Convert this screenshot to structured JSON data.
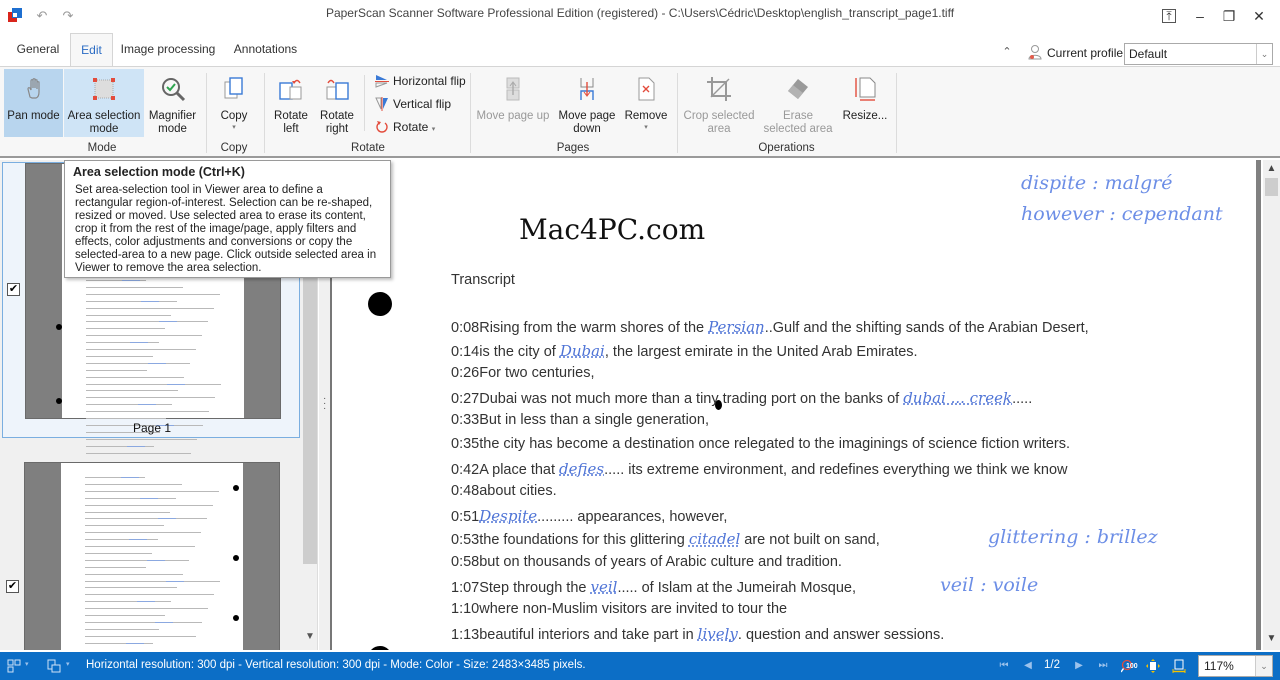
{
  "window": {
    "title": "PaperScan Scanner Software Professional Edition (registered) - C:\\Users\\Cédric\\Desktop\\english_transcript_page1.tiff",
    "undo_icon": "↶",
    "redo_icon": "↷",
    "pin_icon": "⤒",
    "minimize_icon": "–",
    "restore_icon": "❐",
    "close_icon": "✕"
  },
  "ribbon_tabs": [
    {
      "label": "General",
      "active": false
    },
    {
      "label": "Edit",
      "active": true
    },
    {
      "label": "Image processing",
      "active": false
    },
    {
      "label": "Annotations",
      "active": false
    }
  ],
  "profile": {
    "collapse_icon": "⌃",
    "label": "Current profile:",
    "value": "Default",
    "arrow": "⌄"
  },
  "ribbon": {
    "groups": {
      "mode": "Mode",
      "copy": "Copy",
      "rotate": "Rotate",
      "pages": "Pages",
      "operations": "Operations"
    },
    "buttons": {
      "pan_mode": "Pan mode",
      "area_selection_l1": "Area selection",
      "area_selection_l2": "mode",
      "magnifier_l1": "Magnifier",
      "magnifier_l2": "mode",
      "copy": "Copy",
      "rotate_left_l1": "Rotate",
      "rotate_left_l2": "left",
      "rotate_right_l1": "Rotate",
      "rotate_right_l2": "right",
      "horizontal_flip": "Horizontal flip",
      "vertical_flip": "Vertical flip",
      "rotate": "Rotate",
      "move_page_up": "Move page up",
      "move_page_down_l1": "Move page",
      "move_page_down_l2": "down",
      "remove": "Remove",
      "crop_l1": "Crop selected",
      "crop_l2": "area",
      "erase_l1": "Erase",
      "erase_l2": "selected area",
      "resize": "Resize..."
    },
    "dropdown_arrow": "▾"
  },
  "tooltip": {
    "title": "Area selection mode (Ctrl+K)",
    "body": "Set area-selection tool in Viewer area to define a rectangular region-of-interest. Selection can be re-shaped, resized or moved. Use selected area to erase its content, crop it from the rest of the image/page, apply filters and effects, color adjustments and conversions or copy the selected-area to a new page. Click outside selected area in Viewer to remove the area selection."
  },
  "thumbnails": [
    {
      "label": "Page 1",
      "checked": true,
      "selected": true
    },
    {
      "label": "",
      "checked": true,
      "selected": false
    }
  ],
  "check_mark": "✔",
  "document": {
    "watermark": "Mac4PC.com",
    "heading": "Transcript",
    "lines": [
      {
        "ts": "0:08",
        "pre": "Rising from the warm shores of the ",
        "fill": "Persian",
        "post": "..Gulf and the shifting sands of the Arabian Desert,"
      },
      {
        "ts": "0:14",
        "pre": "is the city of ",
        "fill": "Dubai",
        "post": ", the largest emirate in the United Arab Emirates."
      },
      {
        "ts": "0:26",
        "pre": "For two centuries,",
        "fill": "",
        "post": ""
      },
      {
        "ts": "0:27",
        "pre": "Dubai was not much more than a tiny trading port on the banks of ",
        "fill": "dubai ... creek",
        "post": "....."
      },
      {
        "ts": "0:33",
        "pre": "But in less than a single generation,",
        "fill": "",
        "post": ""
      },
      {
        "ts": "0:35",
        "pre": "the city has become a destination once relegated to the imaginings of science fiction writers.",
        "fill": "",
        "post": ""
      },
      {
        "ts": "0:42",
        "pre": "A place that ",
        "fill": "defies",
        "post": "..... its extreme environment, and redefines everything we think we know"
      },
      {
        "ts": "0:48",
        "pre": "about cities.",
        "fill": "",
        "post": ""
      },
      {
        "ts": "0:51",
        "pre": "",
        "fill": "Despite",
        "post": "......... appearances, however,"
      },
      {
        "ts": "0:53",
        "pre": "the foundations for this glittering ",
        "fill": "citadel",
        "post": " are not built on sand,"
      },
      {
        "ts": "0:58",
        "pre": "but on thousands of years of Arabic culture and tradition.",
        "fill": "",
        "post": ""
      },
      {
        "ts": "1:07",
        "pre": "Step through the ",
        "fill": "veil",
        "post": "..... of Islam at the Jumeirah Mosque,"
      },
      {
        "ts": "1:10",
        "pre": "where non-Muslim visitors are invited to tour the",
        "fill": "",
        "post": ""
      },
      {
        "ts": "1:13",
        "pre": "beautiful interiors and take part in ",
        "fill": "lively",
        "post": ". question and answer sessions."
      }
    ],
    "margin_notes": [
      "dispite : malgré",
      "however : cependant",
      "glittering : brillez",
      "veil : voile"
    ]
  },
  "scrollbar": {
    "up": "▲",
    "down": "▼"
  },
  "statusbar": {
    "text": "Horizontal resolution:  300 dpi - Vertical resolution:  300 dpi - Mode: Color - Size: 2483×3485 pixels.",
    "first_icon": "⏮",
    "prev_icon": "◀",
    "page_counter": "1/2",
    "next_icon": "▶",
    "last_icon": "⏭",
    "zoom_value": "117%",
    "zoom_arrow": "⌄",
    "dropdown_arrow": "▾"
  },
  "colors": {
    "accent": "#2b6cc4",
    "statusbar": "#0c6ec6",
    "selected_button": "#b8d5ee",
    "handwriting": "#4f74d6"
  }
}
